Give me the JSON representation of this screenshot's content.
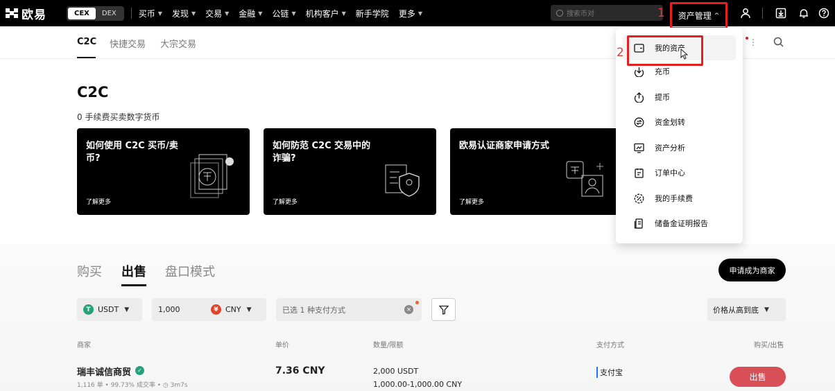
{
  "topnav": {
    "logo_text": "欧易",
    "seg_cex": "CEX",
    "seg_dex": "DEX",
    "items": [
      "买币",
      "发现",
      "交易",
      "金融",
      "公链",
      "机构客户",
      "新手学院",
      "更多"
    ],
    "search_placeholder": "搜索币对",
    "asset_menu": "资产管理",
    "step_1": "1",
    "icons": [
      "user-icon",
      "download-icon",
      "bell-icon",
      "help-icon"
    ]
  },
  "subnav": {
    "tabs": [
      "C2C",
      "快捷交易",
      "大宗交易"
    ],
    "active_tab": "C2C"
  },
  "hero": {
    "title": "C2C",
    "subtitle": "0 手续费买卖数字货币",
    "cards": [
      {
        "title": "如何使用 C2C 买币/卖币?",
        "more": "了解更多"
      },
      {
        "title": "如何防范 C2C 交易中的诈骗?",
        "more": "了解更多"
      },
      {
        "title": "欧易认证商家申请方式",
        "more": "了解更多"
      }
    ]
  },
  "trade": {
    "tabs": [
      "购买",
      "出售",
      "盘口模式"
    ],
    "active_tab": "出售",
    "merchant_button": "申请成为商家",
    "filters": {
      "coin": "USDT",
      "amount": "1,000",
      "fiat": "CNY",
      "payment": "已选 1 种支付方式",
      "sort": "价格从高到底"
    },
    "columns": [
      "商家",
      "单价",
      "数量/限额",
      "支付方式",
      "购买/出售"
    ],
    "rows": [
      {
        "merchant": "瑞丰诚信商贸",
        "stats_orders": "1,116 单",
        "stats_rate": "99.73% 成交率",
        "stats_time": "3m7s",
        "price": "7.36 CNY",
        "quantity": "2,000 USDT",
        "limit": "1,000.00-1,000.00 CNY",
        "payment": "支付宝",
        "action": "出售"
      }
    ]
  },
  "dropdown": {
    "step_2": "2",
    "items": [
      {
        "label": "我的资产",
        "icon": "wallet-icon"
      },
      {
        "label": "充币",
        "icon": "deposit-icon"
      },
      {
        "label": "提币",
        "icon": "withdraw-icon"
      },
      {
        "label": "资金划转",
        "icon": "transfer-icon"
      },
      {
        "label": "资产分析",
        "icon": "analysis-icon"
      },
      {
        "label": "订单中心",
        "icon": "orders-icon"
      },
      {
        "label": "我的手续费",
        "icon": "fee-icon"
      },
      {
        "label": "储备金证明报告",
        "icon": "reserve-report-icon"
      }
    ]
  },
  "colors": {
    "highlight_red": "#e1201f",
    "sell_button": "#d84f58",
    "usdt_green": "#26a17b",
    "cny_red": "#e0452c"
  }
}
